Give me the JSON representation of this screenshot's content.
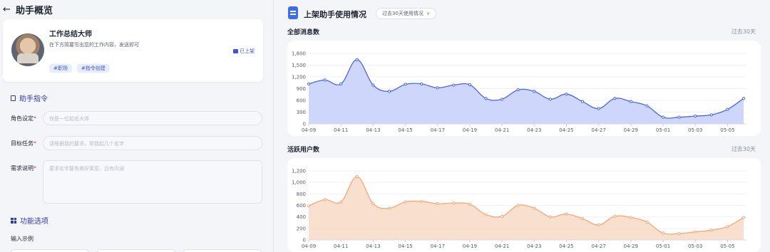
{
  "header": {
    "back_glyph": "←",
    "title": "助手概览"
  },
  "assistant": {
    "name": "工作总结大师",
    "description": "在下方简要写出您的工作内容，发送即可",
    "status": "已上架",
    "tags": [
      "#职场",
      "#指令创建"
    ]
  },
  "instructions": {
    "section_title": "助手指令",
    "role_label": "角色设定",
    "role_placeholder": "你是一位起名大师",
    "goal_label": "目标任务",
    "goal_placeholder": "请根据我的要求，帮我起几个名字",
    "req_label": "需求说明",
    "req_placeholder": "要求名字要有美好寓意，且有内涵",
    "required_mark": "*"
  },
  "features": {
    "section_title": "功能选项",
    "examples_label": "输入示例"
  },
  "stats": {
    "title": "上架助手使用情况",
    "range_label": "过去30天使用情况",
    "range_chevron": "∨"
  },
  "colors": {
    "accent": "#3b56d9",
    "line1": "#4a67e0",
    "fill1": "#c9d1fb",
    "line2": "#f0a87a",
    "fill2": "#f8dcc8"
  },
  "chart_data": [
    {
      "type": "area",
      "title": "全部消息数",
      "period": "过去30天",
      "x": [
        "04-09",
        "04-10",
        "04-11",
        "04-12",
        "04-13",
        "04-14",
        "04-15",
        "04-16",
        "04-17",
        "04-18",
        "04-19",
        "04-20",
        "04-21",
        "04-22",
        "04-23",
        "04-24",
        "04-25",
        "04-26",
        "04-27",
        "04-28",
        "04-29",
        "04-30",
        "05-01",
        "05-02",
        "05-03",
        "05-04",
        "05-05",
        "05-06"
      ],
      "values": [
        1020,
        1120,
        1020,
        1640,
        990,
        830,
        1010,
        1020,
        920,
        990,
        1000,
        650,
        630,
        870,
        830,
        630,
        760,
        570,
        390,
        650,
        570,
        460,
        170,
        170,
        200,
        230,
        370,
        650
      ],
      "xticks": [
        "04-09",
        "04-11",
        "04-13",
        "04-15",
        "04-17",
        "04-19",
        "04-21",
        "04-23",
        "04-25",
        "04-27",
        "04-29",
        "05-01",
        "05-03",
        "05-05"
      ],
      "ylim": [
        0,
        1800
      ],
      "yticks": [
        0,
        300,
        600,
        900,
        1200,
        1500,
        1800
      ],
      "ytick_labels": [
        "0",
        "300",
        "600",
        "900",
        "1,200",
        "1,500",
        "1,800"
      ]
    },
    {
      "type": "area",
      "title": "活跃用户数",
      "period": "过去30天",
      "x": [
        "04-09",
        "04-10",
        "04-11",
        "04-12",
        "04-13",
        "04-14",
        "04-15",
        "04-16",
        "04-17",
        "04-18",
        "04-19",
        "04-20",
        "04-21",
        "04-22",
        "04-23",
        "04-24",
        "04-25",
        "04-26",
        "04-27",
        "04-28",
        "04-29",
        "04-30",
        "05-01",
        "05-02",
        "05-03",
        "05-04",
        "05-05",
        "05-06"
      ],
      "values": [
        590,
        700,
        660,
        1100,
        630,
        550,
        660,
        670,
        630,
        640,
        620,
        440,
        410,
        600,
        550,
        400,
        450,
        370,
        260,
        410,
        390,
        310,
        120,
        110,
        140,
        170,
        230,
        390
      ],
      "xticks": [
        "04-09",
        "04-11",
        "04-13",
        "04-15",
        "04-17",
        "04-19",
        "04-21",
        "04-23",
        "04-25",
        "04-27",
        "04-29",
        "05-01",
        "05-03",
        "05-05"
      ],
      "ylim": [
        0,
        1200
      ],
      "yticks": [
        0,
        200,
        400,
        600,
        800,
        1000,
        1200
      ],
      "ytick_labels": [
        "0",
        "200",
        "400",
        "600",
        "800",
        "1,000",
        "1,200"
      ]
    }
  ]
}
